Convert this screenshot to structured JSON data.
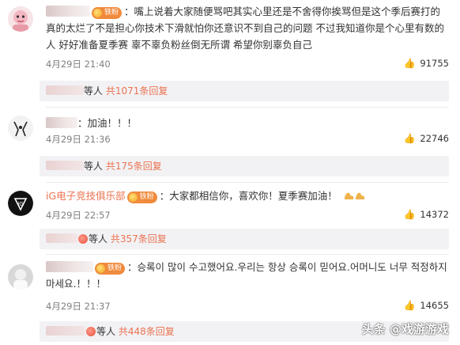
{
  "comments": [
    {
      "badge": "铁粉",
      "text": "嘴上说着大家随便骂吧其实心里还是不舍得你挨骂但是这个季后赛打的真的太烂了不是担心你技术下滑就怕你还意识不到自己的问题 不过我知道你是个心里有数的人 好好准备夏季赛 辜不辜负粉丝倒无所谓 希望你别辜负自己",
      "date": "4月29日 21:40",
      "likes": "91755",
      "reply_who": "等人",
      "reply_link": "共1071条回复"
    },
    {
      "badge": "",
      "text": "加油！！！",
      "date": "4月29日 21:36",
      "likes": "22746",
      "reply_who": "等人",
      "reply_link": "共175条回复"
    },
    {
      "username": "iG电子竞技俱乐部",
      "badge": "铁粉",
      "text": "大家都相信你，喜欢你！夏季赛加油！",
      "date": "4月29日 22:57",
      "likes": "14372",
      "reply_who": "等人",
      "reply_link": "共357条回复"
    },
    {
      "badge": "铁粉",
      "text": "승록이 많이 수고했어요.우리는 항상 승록이 믿어요.어머니도 너무 적정하지 마세요.！！！",
      "date": "4月29日 21:37",
      "likes": "14655",
      "reply_who": "等人",
      "reply_link": "共448条回复"
    }
  ],
  "colors": {
    "accent": "#eb7350",
    "meta": "#808080",
    "reply_bg": "#f2f2f5",
    "badge": "#f08a3c"
  },
  "icons": {
    "like": "thumb-up-icon"
  },
  "watermark": "头条 @戏游游戏"
}
